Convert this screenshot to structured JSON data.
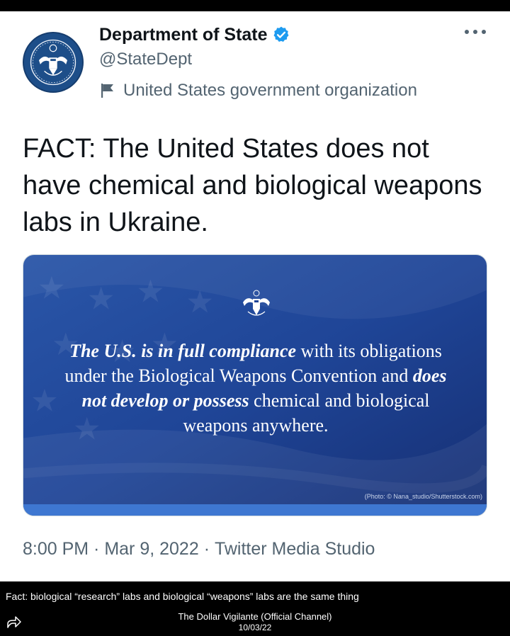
{
  "tweet": {
    "display_name": "Department of State",
    "handle": "@StateDept",
    "label": "United States government organization",
    "text": "FACT: The United States does not have chemical and biological weapons labs in Ukraine.",
    "media": {
      "quote_parts": [
        {
          "text": "The U.S. is in full compliance",
          "style": "bold-italic"
        },
        {
          "text": " with its obligations under the Biological Weapons Convention and ",
          "style": "normal"
        },
        {
          "text": "does not develop or possess",
          "style": "bold-italic"
        },
        {
          "text": " chemical and biological weapons anywhere.",
          "style": "normal"
        }
      ],
      "photo_credit": "(Photo: © Nana_studio/Shutterstock.com)"
    },
    "time": "8:00 PM",
    "separator": " · ",
    "date": "Mar 9, 2022",
    "source": "Twitter Media Studio"
  },
  "post": {
    "caption": "Fact: biological “research” labs and biological “weapons” labs are the same thing",
    "channel": "The Dollar Vigilante (Official Channel)",
    "date": "10/03/22"
  },
  "colors": {
    "verified": "#1d9bf0",
    "media_blue": "#1f4597",
    "text_secondary": "#536471"
  },
  "icons": {
    "verified": "verified-badge-icon",
    "label": "flag-icon",
    "more": "more-icon",
    "share": "share-icon"
  }
}
